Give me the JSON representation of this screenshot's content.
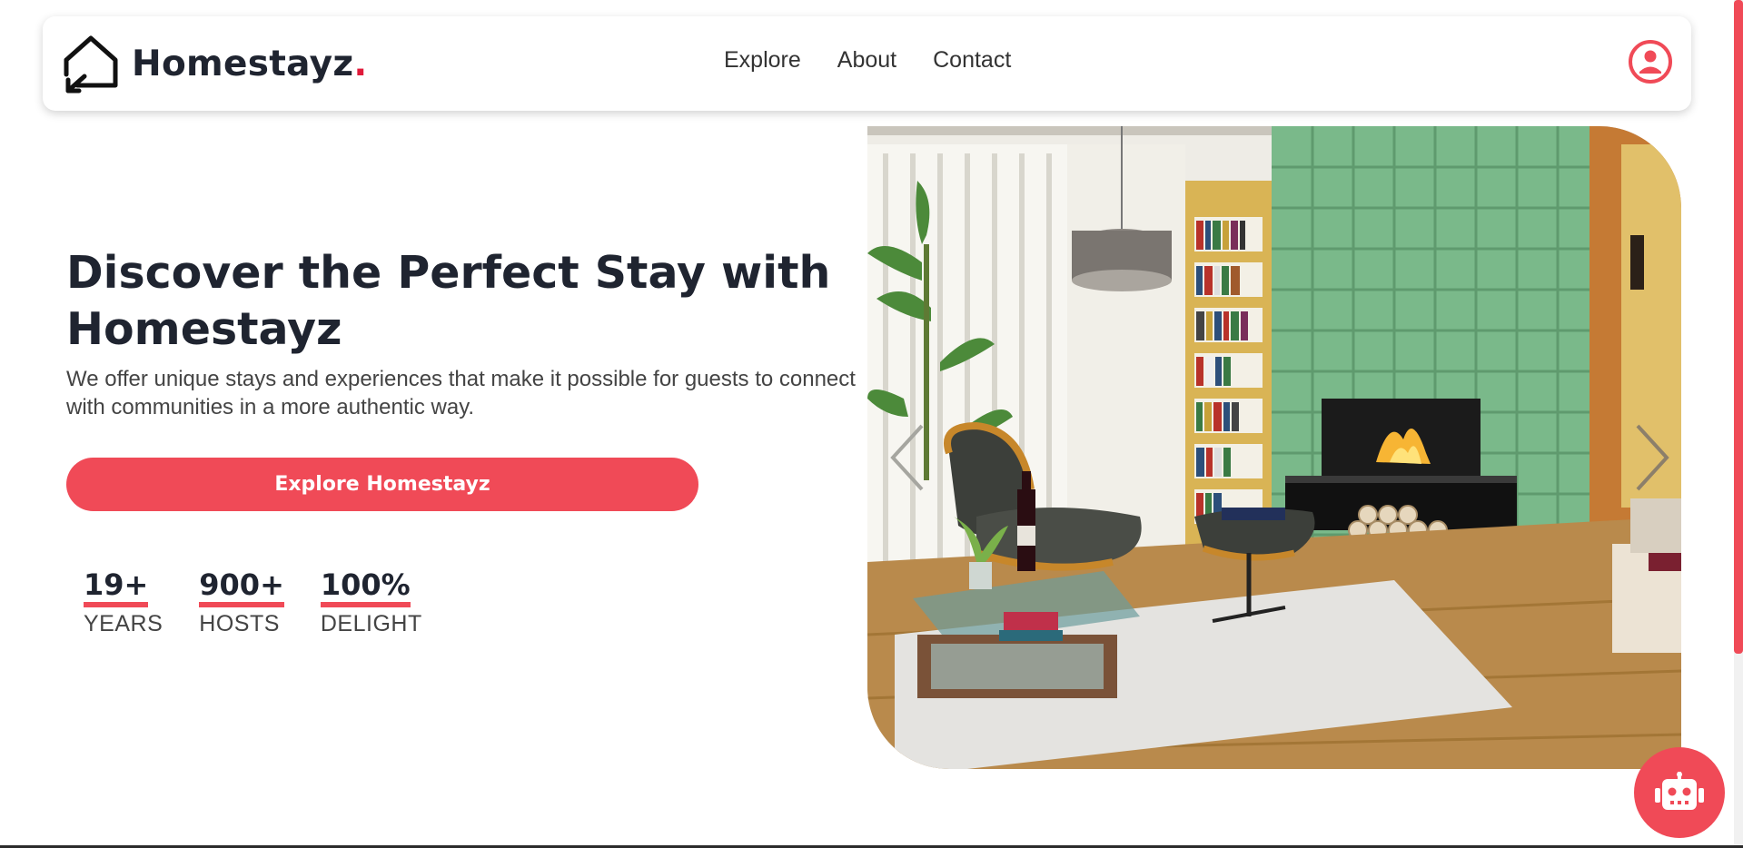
{
  "brand": {
    "name": "Homestayz",
    "dot": "."
  },
  "nav": {
    "links": [
      "Explore",
      "About",
      "Contact"
    ]
  },
  "hero": {
    "title": "Discover the Perfect Stay with Homestayz",
    "subtitle": "We offer unique stays and experiences that make it possible for guests to connect with communities in a more authentic way.",
    "cta": "Explore Homestayz"
  },
  "stats": [
    {
      "value": "19+",
      "label": "YEARS"
    },
    {
      "value": "900+",
      "label": "HOSTS"
    },
    {
      "value": "100%",
      "label": "DELIGHT"
    }
  ],
  "colors": {
    "accent": "#f04a57",
    "text": "#1f2430",
    "brand_dot": "#e01a3a"
  },
  "icons": {
    "logo": "house-arrow-icon",
    "user": "user-circle-icon",
    "chatbot": "robot-icon",
    "prev": "chevron-left-icon",
    "next": "chevron-right-icon"
  }
}
